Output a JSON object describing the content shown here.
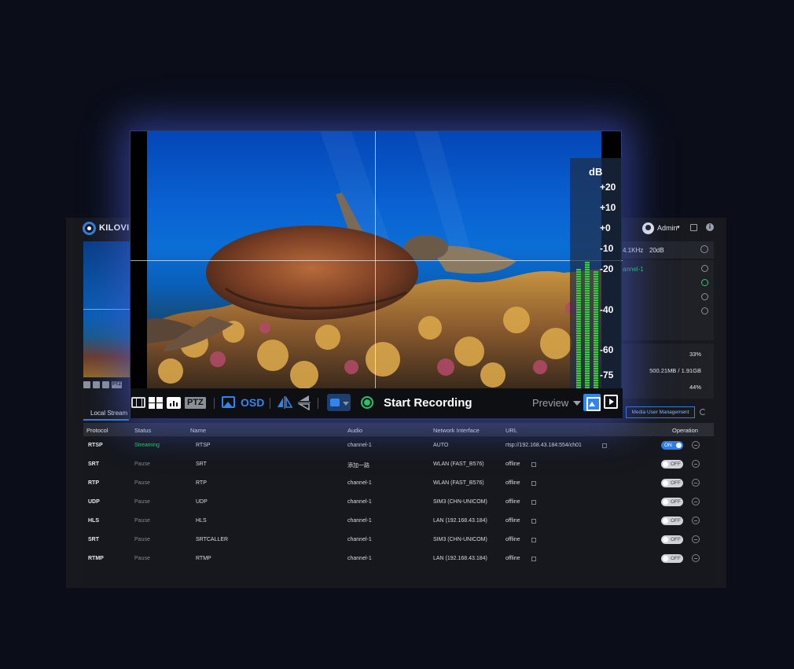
{
  "app": {
    "logo_text": "KILOVIEW",
    "user_name": "Admin",
    "colors": {
      "accent": "#2f7fe6",
      "streaming": "#2fc76c",
      "background": "#0b0e19"
    }
  },
  "audio_info": {
    "sample_rate": "4.1KHz",
    "gain": "20dB",
    "channel_link": "annel-1"
  },
  "stats": {
    "cpu": "33%",
    "memory": "500.21MB / 1.91GB",
    "storage": "44%"
  },
  "mini_toolbar": {
    "ptz": "PTZ"
  },
  "tabs": {
    "local_stream": "Local Stream",
    "media_user_management": "Media User Management"
  },
  "table": {
    "headers": [
      "Protocol",
      "Status",
      "Name",
      "Audio",
      "Network Interface",
      "URL",
      "Operation"
    ],
    "rows": [
      {
        "protocol": "RTSP",
        "status": "Streaming",
        "name": "RTSP",
        "audio": "channel-1",
        "network": "AUTO",
        "url": "rtsp://192.168.43.184:554/ch01",
        "toggle": "ON",
        "on": true
      },
      {
        "protocol": "SRT",
        "status": "Pause",
        "name": "SRT",
        "audio": "添加一路",
        "network": "WLAN (FAST_B576)",
        "url": "offline",
        "toggle": "OFF",
        "on": false
      },
      {
        "protocol": "RTP",
        "status": "Pause",
        "name": "RTP",
        "audio": "channel-1",
        "network": "WLAN (FAST_B576)",
        "url": "offline",
        "toggle": "OFF",
        "on": false
      },
      {
        "protocol": "UDP",
        "status": "Pause",
        "name": "UDP",
        "audio": "channel-1",
        "network": "SIM3 (CHN-UNICOM)",
        "url": "offline",
        "toggle": "OFF",
        "on": false
      },
      {
        "protocol": "HLS",
        "status": "Pause",
        "name": "HLS",
        "audio": "channel-1",
        "network": "LAN (192.168.43.184)",
        "url": "offline",
        "toggle": "OFF",
        "on": false
      },
      {
        "protocol": "SRT",
        "status": "Pause",
        "name": "SRTCALLER",
        "audio": "channel-1",
        "network": "SIM3 (CHN-UNICOM)",
        "url": "offline",
        "toggle": "OFF",
        "on": false
      },
      {
        "protocol": "RTMP",
        "status": "Pause",
        "name": "RTMP",
        "audio": "channel-1",
        "network": "LAN (192.168.43.184)",
        "url": "offline",
        "toggle": "OFF",
        "on": false
      }
    ]
  },
  "audio_meter": {
    "unit": "dB",
    "ticks": [
      "+20",
      "+10",
      "+0",
      "-10",
      "-20",
      "-40",
      "-60",
      "-75"
    ],
    "levels": [
      0.52,
      0.55,
      0.51
    ]
  },
  "player_toolbar": {
    "ptz": "PTZ",
    "osd": "OSD",
    "record": "Start Recording",
    "preview_mode": "Preview"
  },
  "icons": {
    "layout_single": "layout-single-icon",
    "layout_quad": "layout-quad-icon",
    "level": "audio-level-icon",
    "osd": "osd-image-icon",
    "mirror": "mirror-icon",
    "flip": "flip-icon",
    "stream": "stream-source-icon",
    "record": "record-icon",
    "image_mode": "image-mode-icon",
    "video_mode": "video-mode-icon"
  }
}
